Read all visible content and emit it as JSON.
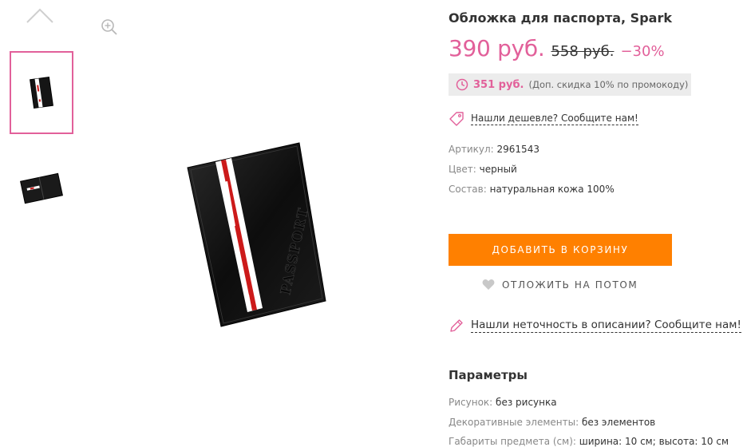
{
  "gallery": {
    "up_icon": "chevron-up-icon",
    "zoom_icon": "zoom-in-icon"
  },
  "product": {
    "title": "Обложка для паспорта, Spark",
    "price": "390 руб.",
    "old_price": "558 руб.",
    "discount": "−30%",
    "promo_price": "351 руб.",
    "promo_note": "(Доп. скидка 10% по промокоду)",
    "cheaper_link": "Нашли дешевле? Сообщите нам!",
    "attributes": [
      {
        "key": "Артикул:",
        "value": "2961543"
      },
      {
        "key": "Цвет:",
        "value": "черный"
      },
      {
        "key": "Состав:",
        "value": "натуральная кожа 100%"
      }
    ],
    "add_to_cart": "ДОБАВИТЬ В КОРЗИНУ",
    "save_later": "ОТЛОЖИТЬ НА ПОТОМ",
    "error_link": "Нашли неточность в описании? Сообщите нам!",
    "params_title": "Параметры",
    "params": [
      {
        "key": "Рисунок:",
        "value": "без рисунка"
      },
      {
        "key": "Декоративные элементы:",
        "value": "без элементов"
      },
      {
        "key": "Габариты предмета (см):",
        "value": "ширина: 10 см; высота: 10 см"
      }
    ],
    "cover_text": "PASSPORT"
  },
  "colors": {
    "accent": "#e2609a",
    "button": "#ff8000",
    "promo_bg": "#ececec"
  }
}
